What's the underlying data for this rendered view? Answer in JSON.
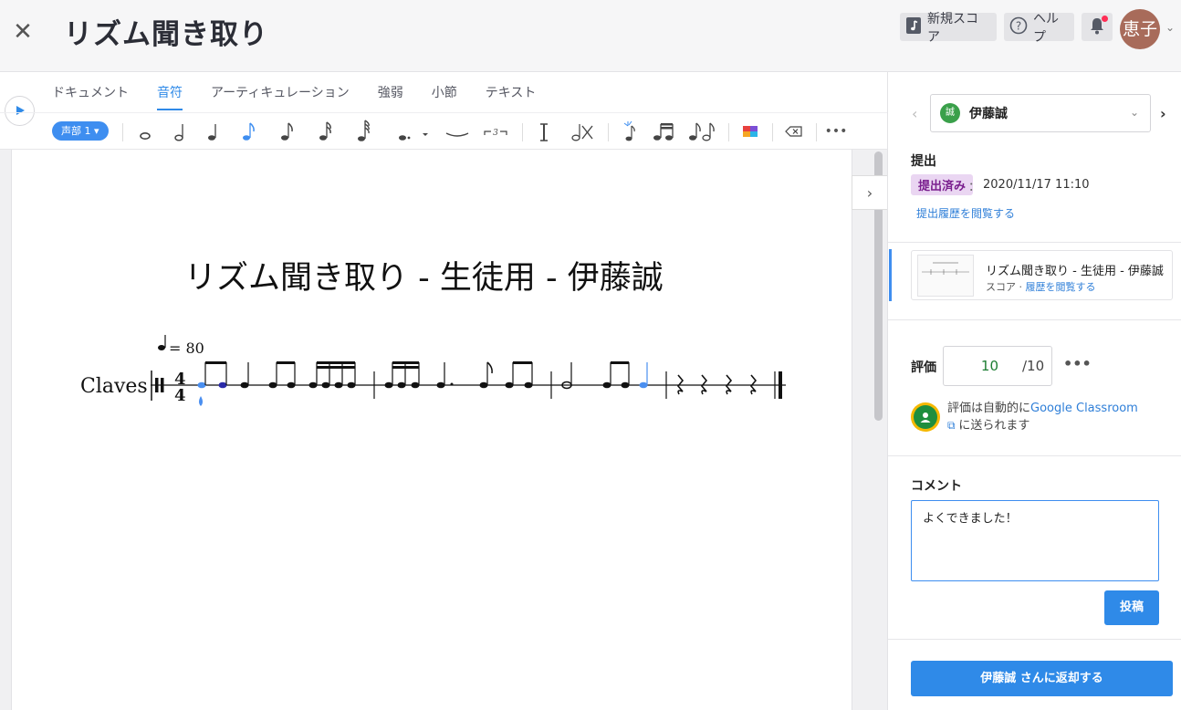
{
  "header": {
    "title": "リズム聞き取り",
    "new_score_label": "新規スコア",
    "help_label": "ヘルプ",
    "avatar_text": "恵子"
  },
  "toolbar": {
    "tabs": [
      "ドキュメント",
      "音符",
      "アーティキュレーション",
      "強弱",
      "小節",
      "テキスト"
    ],
    "active_tab": "音符",
    "voice_label": "声部 1",
    "tools": [
      "whole-note",
      "half-note",
      "quarter-note",
      "eighth-note",
      "eighth-note",
      "sixteenth-note",
      "thirty-second-note",
      "dotted-note",
      "tie",
      "tuplet",
      "stem-up",
      "flat-note",
      "grace-note",
      "beam",
      "pair-notes",
      "colors",
      "delete",
      "more"
    ]
  },
  "score": {
    "title": "リズム聞き取り - 生徒用 - 伊藤誠",
    "tempo_text": "= 80",
    "instrument": "Claves",
    "time_signature_top": "4",
    "time_signature_bottom": "4"
  },
  "side": {
    "student_name": "伊藤誠",
    "student_badge": "誠",
    "submission_heading": "提出",
    "submission_status": "提出済み",
    "submission_time": "2020/11/17 11:10",
    "submission_time_sep": "：",
    "submission_history_link": "提出履歴を閲覧する",
    "score_card_title": "リズム聞き取り - 生徒用 - 伊藤誠",
    "score_card_type": "スコア · ",
    "score_card_link": "履歴を閲覧する",
    "grade_heading": "評価",
    "grade_value": "10",
    "grade_max": "/10",
    "grade_more": "•••",
    "gc_text_prefix": "評価は自動的に",
    "gc_link": "Google Classroom",
    "gc_text_suffix": "に送られます",
    "comment_heading": "コメント",
    "comment_value": "よくできました！",
    "post_label": "投稿",
    "return_label": "伊藤誠 さんに返却する"
  }
}
